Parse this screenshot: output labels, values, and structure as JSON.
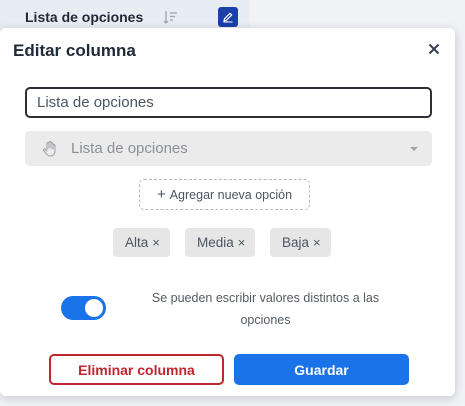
{
  "header": {
    "column_title": "Lista de opciones",
    "sort_icon": "sort-list-icon",
    "edit_icon": "pencil-icon"
  },
  "dialog": {
    "title": "Editar columna",
    "close_icon": "close-icon",
    "name_input": {
      "value": "Lista de opciones",
      "placeholder": ""
    },
    "type_select": {
      "icon": "hand-pointer-icon",
      "selected": "Lista de opciones"
    },
    "add_option_label": "Agregar nueva opción",
    "options": [
      {
        "label": "Alta"
      },
      {
        "label": "Media"
      },
      {
        "label": "Baja"
      }
    ],
    "remove_symbol": "×",
    "free_values_toggle": {
      "on": true,
      "label": "Se pueden escribir valores distintos a las opciones"
    },
    "delete_button": "Eliminar columna",
    "save_button": "Guardar"
  },
  "colors": {
    "accent": "#1a73e8",
    "danger": "#c0262d",
    "edit_badge": "#1c3faa"
  }
}
